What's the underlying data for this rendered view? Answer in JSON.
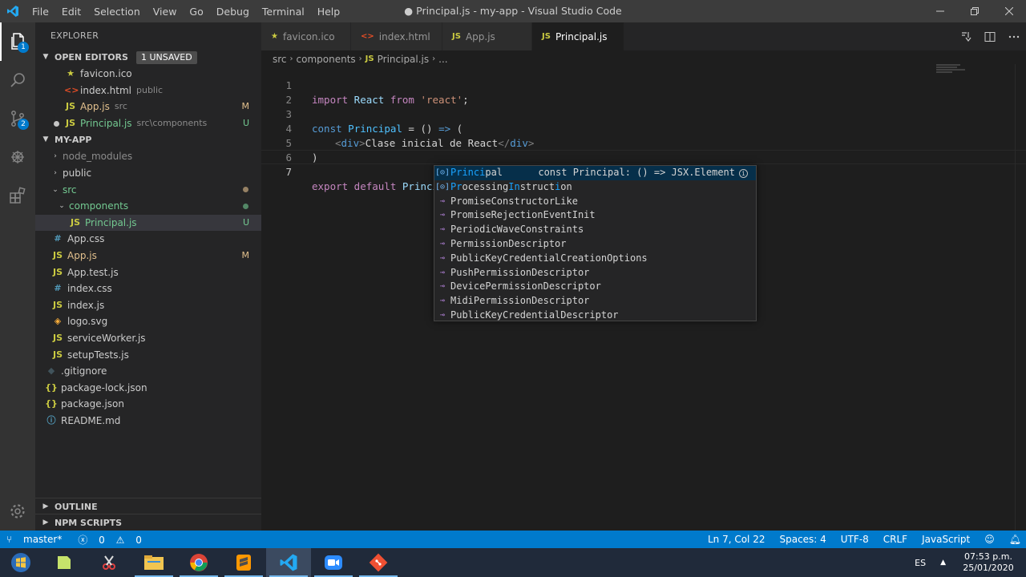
{
  "window": {
    "title": "● Principal.js - my-app - Visual Studio Code",
    "menu": [
      "File",
      "Edit",
      "Selection",
      "View",
      "Go",
      "Debug",
      "Terminal",
      "Help"
    ]
  },
  "activity": {
    "explorer_badge": "1",
    "scm_badge": "2"
  },
  "sidebar": {
    "title": "EXPLORER",
    "open_editors": {
      "label": "OPEN EDITORS",
      "unsaved": "1 UNSAVED",
      "items": [
        {
          "icon": "★",
          "name": "favicon.ico",
          "desc": "",
          "status": ""
        },
        {
          "icon": "<>",
          "name": "index.html",
          "desc": "public",
          "status": ""
        },
        {
          "icon": "JS",
          "name": "App.js",
          "desc": "src",
          "status": "M"
        },
        {
          "icon": "JS",
          "name": "Principal.js",
          "desc": "src\\components",
          "status": "U"
        }
      ]
    },
    "project": {
      "label": "MY-APP",
      "tree": [
        {
          "name": "node_modules",
          "icon": "›",
          "status": ""
        },
        {
          "name": "public",
          "icon": "›",
          "status": ""
        },
        {
          "name": "src",
          "icon": "⌄",
          "status": ""
        },
        {
          "name": "components",
          "icon": "⌄",
          "status": ""
        },
        {
          "name": "Principal.js",
          "icon": "JS",
          "status": "U"
        },
        {
          "name": "App.css",
          "icon": "#",
          "status": ""
        },
        {
          "name": "App.js",
          "icon": "JS",
          "status": "M"
        },
        {
          "name": "App.test.js",
          "icon": "JS",
          "status": ""
        },
        {
          "name": "index.css",
          "icon": "#",
          "status": ""
        },
        {
          "name": "index.js",
          "icon": "JS",
          "status": ""
        },
        {
          "name": "logo.svg",
          "icon": "◈",
          "status": ""
        },
        {
          "name": "serviceWorker.js",
          "icon": "JS",
          "status": ""
        },
        {
          "name": "setupTests.js",
          "icon": "JS",
          "status": ""
        },
        {
          "name": ".gitignore",
          "icon": "◆",
          "status": ""
        },
        {
          "name": "package-lock.json",
          "icon": "{}",
          "status": ""
        },
        {
          "name": "package.json",
          "icon": "{}",
          "status": ""
        },
        {
          "name": "README.md",
          "icon": "ⓘ",
          "status": ""
        }
      ]
    },
    "outline_label": "OUTLINE",
    "npm_label": "NPM SCRIPTS"
  },
  "tabs": [
    {
      "icon": "★",
      "label": "favicon.ico"
    },
    {
      "icon": "<>",
      "label": "index.html"
    },
    {
      "icon": "JS",
      "label": "App.js"
    },
    {
      "icon": "JS",
      "label": "Principal.js"
    }
  ],
  "breadcrumb": [
    "src",
    "components",
    "Principal.js",
    "..."
  ],
  "breadcrumb_js": "JS",
  "code": {
    "line_numbers": [
      "1",
      "2",
      "3",
      "4",
      "5",
      "6",
      "7"
    ],
    "l1": {
      "a": "import",
      "b": " React ",
      "c": "from",
      "d": " 'react'",
      "e": ";"
    },
    "l3": {
      "a": "const",
      "b": " Principal",
      "c": " = () ",
      "d": "=>",
      "e": " ("
    },
    "l4": {
      "a": "<",
      "b": "div",
      "c": ">",
      "d": "Clase inicial de React",
      "e": "</",
      "f": "div",
      "g": ">"
    },
    "l5": {
      "a": ")"
    },
    "l7": {
      "a": "export",
      "b": " default",
      "c": " Princi"
    }
  },
  "suggest": {
    "items": [
      {
        "pre": "",
        "hl": "Princi",
        "post": "pal",
        "detail": "const Principal: () => JSX.Element"
      },
      {
        "pre": "",
        "hl": "Pr",
        "mid": "ocessing",
        "hl2": "In",
        "post": "struct",
        "hl3": "i",
        "post2": "on"
      },
      {
        "text": "PromiseConstructorLike"
      },
      {
        "text": "PromiseRejectionEventInit"
      },
      {
        "text": "PeriodicWaveConstraints"
      },
      {
        "text": "PermissionDescriptor"
      },
      {
        "text": "PublicKeyCredentialCreationOptions"
      },
      {
        "text": "PushPermissionDescriptor"
      },
      {
        "text": "DevicePermissionDescriptor"
      },
      {
        "text": "MidiPermissionDescriptor"
      },
      {
        "text": "PublicKeyCredentialDescriptor"
      }
    ]
  },
  "status": {
    "branch": "master*",
    "errors": "0",
    "warnings": "0",
    "position": "Ln 7, Col 22",
    "spaces": "Spaces: 4",
    "encoding": "UTF-8",
    "eol": "CRLF",
    "language": "JavaScript"
  },
  "taskbar": {
    "lang": "ES",
    "time": "07:53 p.m.",
    "date": "25/01/2020"
  }
}
